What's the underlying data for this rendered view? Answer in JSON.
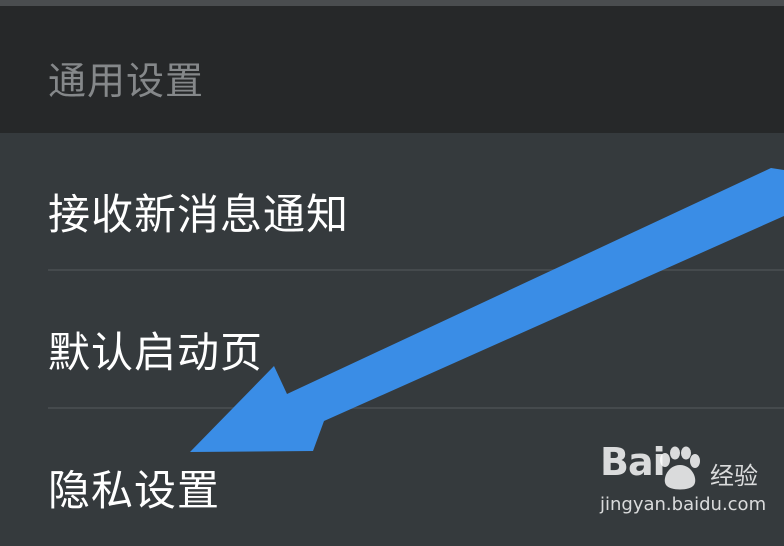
{
  "header": {
    "title": "通用设置"
  },
  "items": [
    {
      "label": "接收新消息通知"
    },
    {
      "label": "默认启动页"
    },
    {
      "label": "隐私设置"
    }
  ],
  "watermark": {
    "logo_text": "Bai",
    "logo_suffix": "经验",
    "url": "jingyan.baidu.com"
  },
  "colors": {
    "header_bg": "#262829",
    "list_bg": "#353a3d",
    "arrow": "#3a8de6"
  },
  "icons": {
    "annotation": "arrow-annotation-icon",
    "watermark": "baidu-paw-icon"
  }
}
